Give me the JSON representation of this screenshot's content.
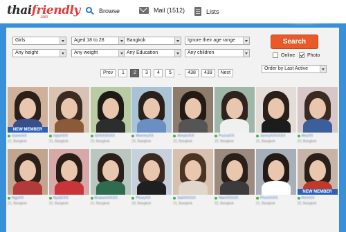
{
  "header": {
    "logo_main": "thai",
    "logo_accent": "friendly",
    "logo_sub": ".com",
    "nav": [
      {
        "label": "Browse",
        "icon": "search-icon"
      },
      {
        "label": "Mail (1512)",
        "icon": "mail-icon"
      },
      {
        "label": "Lists",
        "icon": "lists-icon"
      }
    ]
  },
  "filters": {
    "gender": "Girls",
    "age": "Aged 18 to 28",
    "location": "Bangkok",
    "age_range_pref": "Ignore their age range",
    "height": "Any height",
    "weight": "Any weight",
    "education": "Any Education",
    "children": "Any children"
  },
  "search": {
    "button_label": "Search",
    "online_label": "Online",
    "online_checked": false,
    "photo_label": "Photo",
    "photo_checked": true,
    "order_label": "Order by Last Active"
  },
  "pagination": {
    "prev": "Prev",
    "pages": [
      "1",
      "2",
      "3",
      "4",
      "5"
    ],
    "current": "2",
    "ellipsis": "...",
    "tail_pages": [
      "438",
      "439"
    ],
    "next": "Next"
  },
  "colors": {
    "brand_blue": "#3a8fd9",
    "search_orange": "#ea5a29",
    "badge_blue": "#2b5fb8",
    "online_green": "#41b34a",
    "link_blue": "#4a79c9"
  },
  "profiles": [
    {
      "badge": "NEW MEMBER",
      "username": "suzexXX",
      "info": "21, Bangkok"
    },
    {
      "badge": "",
      "username": "nyjuXXX",
      "info": "21, Bangkok"
    },
    {
      "badge": "",
      "username": "SXXXXXXX",
      "info": "23, Bangkok"
    },
    {
      "badge": "",
      "username": "MornnyXX",
      "info": "23, Bangkok"
    },
    {
      "badge": "",
      "username": "AmaznXX",
      "info": "22, Bangkok"
    },
    {
      "badge": "",
      "username": "PuzzaXX",
      "info": "22, Bangkok"
    },
    {
      "badge": "",
      "username": "JannyXXXXXX",
      "info": "21, Bangkok"
    },
    {
      "badge": "",
      "username": "AeyXX",
      "info": "23, Bangkok"
    },
    {
      "badge": "",
      "username": "NgyXX",
      "info": "21, Bangkok"
    },
    {
      "badge": "",
      "username": "NyalXXX",
      "info": "21, Bangkok"
    },
    {
      "badge": "",
      "username": "BrassmXXXX",
      "info": "21, Bangkok"
    },
    {
      "badge": "",
      "username": "PlooyXX",
      "info": "23, Bangkok"
    },
    {
      "badge": "",
      "username": "SatXXXXX",
      "info": "21, Bangkok"
    },
    {
      "badge": "",
      "username": "NanXXXXX",
      "info": "22, Bangkok"
    },
    {
      "badge": "",
      "username": "PlooXXXX",
      "info": "21, Bangkok"
    },
    {
      "badge": "NEW MEMBER",
      "username": "RemXX",
      "info": "22, Bangkok"
    }
  ]
}
